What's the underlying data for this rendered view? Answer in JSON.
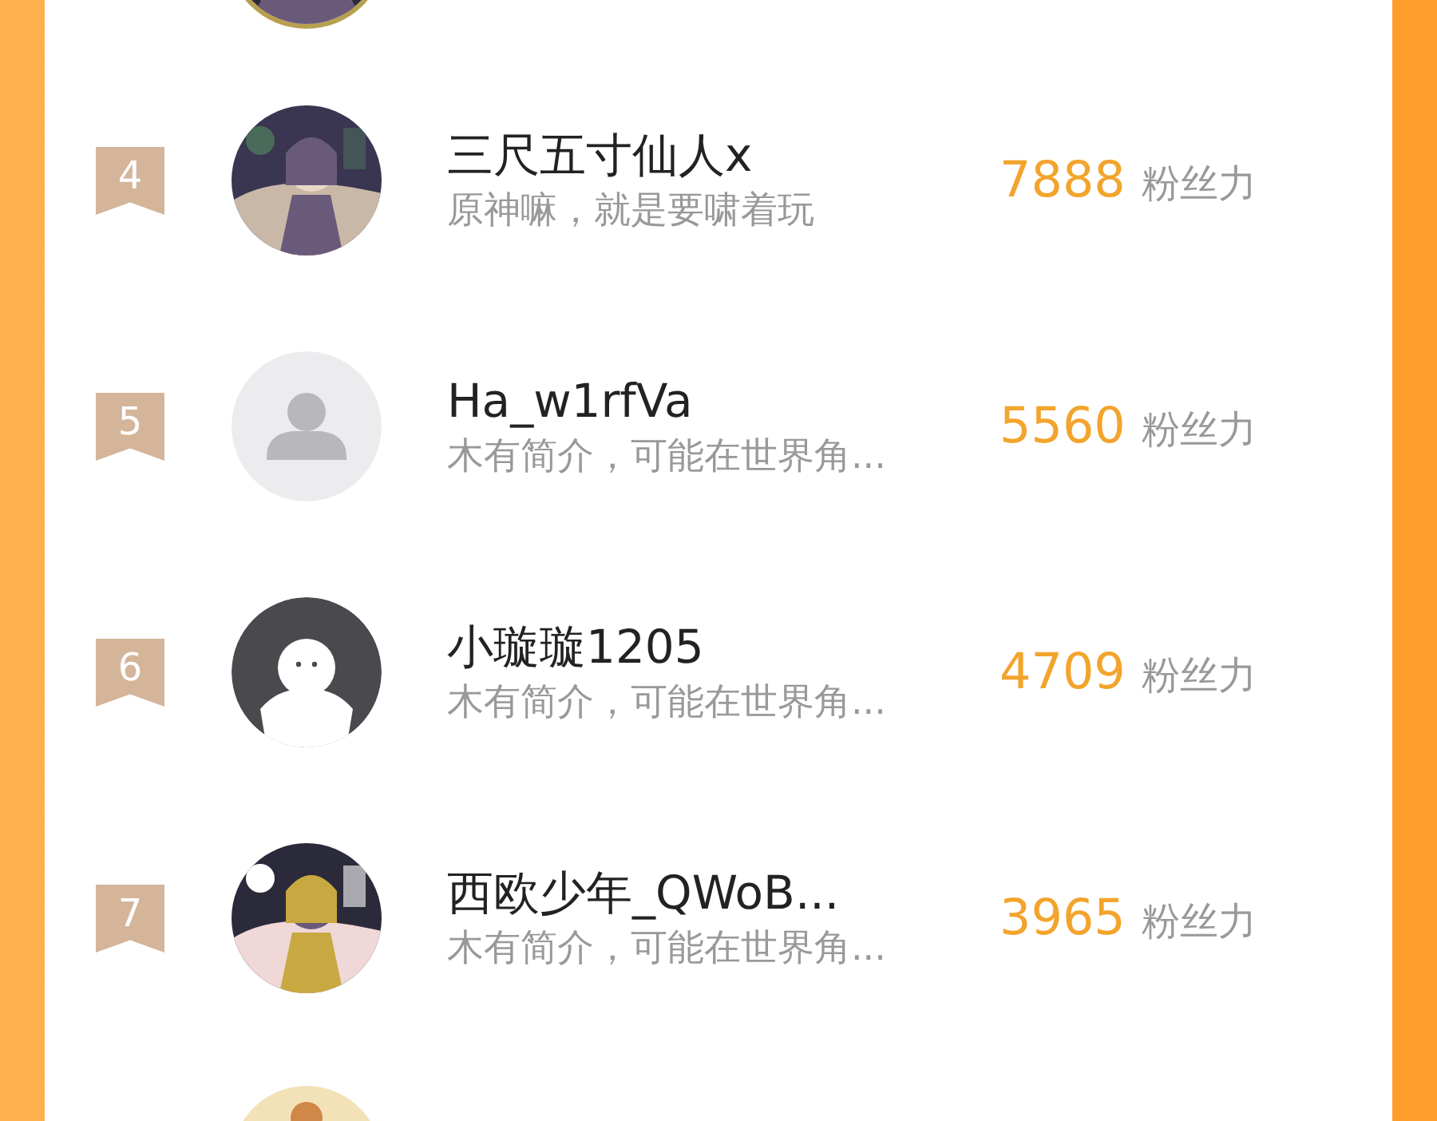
{
  "rankings": [
    {
      "rank": "4",
      "name": "三尺五寸仙人x",
      "bio": "原神嘛，就是要啸着玩",
      "score": "7888",
      "score_unit": "粉丝力"
    },
    {
      "rank": "5",
      "avatar": {
        "kind": "default"
      },
      "name": "Ha_w1rfVa",
      "bio": "木有简介，可能在世界角...",
      "score": "5560",
      "score_unit": "粉丝力"
    },
    {
      "rank": "6",
      "avatar": {
        "kind": "figure"
      },
      "name": "小璇璇1205",
      "bio": "木有简介，可能在世界角...",
      "score": "4709",
      "score_unit": "粉丝力"
    },
    {
      "rank": "7",
      "name": "西欧少年_QWoB...",
      "bio": "木有简介，可能在世界角...",
      "score": "3965",
      "score_unit": "粉丝力"
    }
  ]
}
